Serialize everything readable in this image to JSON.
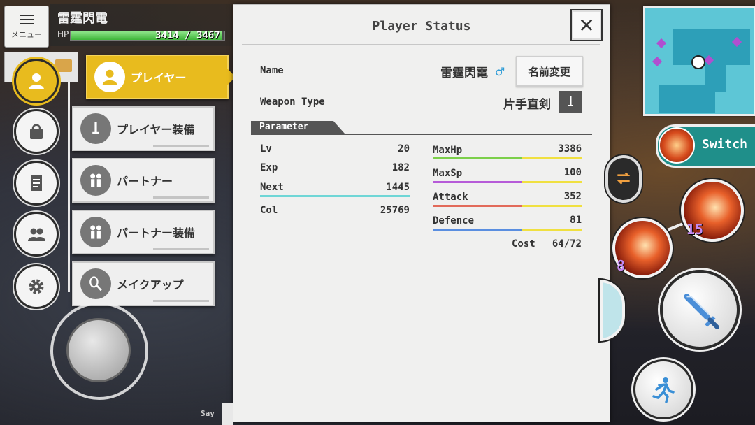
{
  "hud": {
    "menu_label": "メニュー",
    "player_name": "雷霆閃電",
    "hp_label": "HP",
    "hp_text": "3414 / 3467",
    "hp_fraction": 0.985
  },
  "side_menu": {
    "items": [
      {
        "icon": "person-icon",
        "active": true
      },
      {
        "icon": "bag-icon"
      },
      {
        "icon": "document-icon"
      },
      {
        "icon": "party-icon"
      },
      {
        "icon": "gear-icon"
      }
    ]
  },
  "submenu": {
    "items": [
      {
        "label": "プレイヤー",
        "icon": "player-icon",
        "active": true
      },
      {
        "label": "プレイヤー装備",
        "icon": "sword-equip-icon"
      },
      {
        "label": "パートナー",
        "icon": "partner-icon"
      },
      {
        "label": "パートナー装備",
        "icon": "partner-equip-icon"
      },
      {
        "label": "メイクアップ",
        "icon": "makeup-icon"
      }
    ]
  },
  "panel": {
    "title": "Player Status",
    "close_label": "✕",
    "name_label": "Name",
    "name_value": "雷霆閃電",
    "gender_symbol": "♂",
    "rename_label": "名前変更",
    "weapon_label": "Weapon Type",
    "weapon_value": "片手直剣",
    "param_header": "Parameter",
    "left_stats": [
      {
        "label": "Lv",
        "value": "20"
      },
      {
        "label": "Exp",
        "value": "182"
      },
      {
        "label": "Next",
        "value": "1445",
        "bar_color": "#6fd6d6"
      },
      {
        "label": "Col",
        "value": "25769"
      }
    ],
    "right_stats": [
      {
        "label": "MaxHp",
        "value": "3386",
        "bar_color": "#7ccf4a",
        "bar_fraction": 0.6
      },
      {
        "label": "MaxSp",
        "value": "100",
        "bar_color": "#b65bd8",
        "bar_fraction": 0.6
      },
      {
        "label": "Attack",
        "value": "352",
        "bar_color": "#e26a5a",
        "bar_fraction": 0.6
      },
      {
        "label": "Defence",
        "value": "81",
        "bar_color": "#5a8ee0",
        "bar_fraction": 0.6
      }
    ],
    "cost_label": "Cost",
    "cost_value": "64/72"
  },
  "right_hud": {
    "switch_label": "Switch",
    "skill_counts": [
      "15",
      "8"
    ]
  },
  "chat": {
    "say_label": "Say"
  },
  "colors": {
    "accent_yellow": "#e8bb1e",
    "teal": "#1f8f8a",
    "bonus_bar": "#f0e040"
  }
}
